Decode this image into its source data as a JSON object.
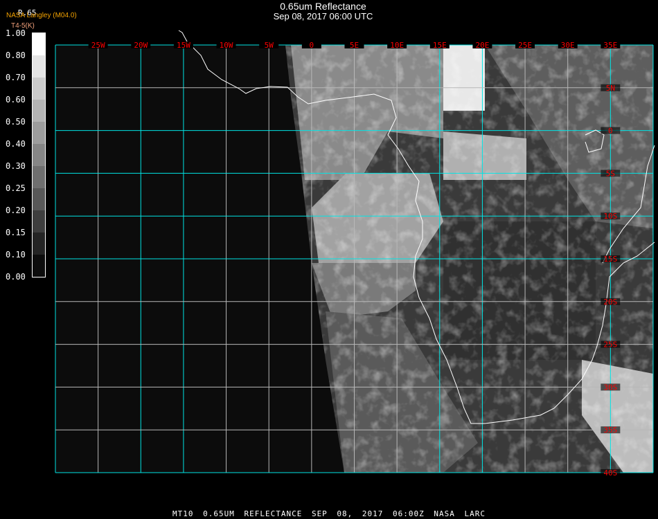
{
  "header": {
    "title": "0.65um Reflectance",
    "subtitle": "Sep 08, 2017 06:00 UTC",
    "band_label": "R.65",
    "organization": "NASA Langley (M04.0)",
    "secondary_label": "T4-5(K)"
  },
  "colorbar": {
    "labels": [
      "1.00",
      "0.80",
      "0.70",
      "0.60",
      "0.50",
      "0.40",
      "0.30",
      "0.25",
      "0.20",
      "0.15",
      "0.10",
      "0.00"
    ],
    "colors": [
      "#ffffff",
      "#e4e4e4",
      "#cbcbcb",
      "#b4b4b4",
      "#9d9d9d",
      "#868686",
      "#6f6f6f",
      "#585858",
      "#3e3e3e",
      "#242424",
      "#0c0c0c"
    ]
  },
  "map": {
    "lon_range": [
      -30,
      40
    ],
    "lat_range": [
      10,
      -40
    ],
    "longitudes": [
      {
        "value": -25,
        "label": "25W"
      },
      {
        "value": -20,
        "label": "20W"
      },
      {
        "value": -15,
        "label": "15W"
      },
      {
        "value": -10,
        "label": "10W"
      },
      {
        "value": -5,
        "label": "5W"
      },
      {
        "value": 0,
        "label": "0"
      },
      {
        "value": 5,
        "label": "5E"
      },
      {
        "value": 10,
        "label": "10E"
      },
      {
        "value": 15,
        "label": "15E"
      },
      {
        "value": 20,
        "label": "20E"
      },
      {
        "value": 25,
        "label": "25E"
      },
      {
        "value": 30,
        "label": "30E"
      },
      {
        "value": 35,
        "label": "35E"
      }
    ],
    "latitudes": [
      {
        "value": 5,
        "label": "5N"
      },
      {
        "value": 0,
        "label": "0"
      },
      {
        "value": -5,
        "label": "5S"
      },
      {
        "value": -10,
        "label": "10S"
      },
      {
        "value": -15,
        "label": "15S"
      },
      {
        "value": -20,
        "label": "20S"
      },
      {
        "value": -25,
        "label": "25S"
      },
      {
        "value": -30,
        "label": "30S"
      },
      {
        "value": -35,
        "label": "35S"
      },
      {
        "value": -40,
        "label": "40S"
      }
    ],
    "grid_color": "#00e5e5",
    "label_color": "#ff0000",
    "coast_color": "#ffffff"
  },
  "footer": {
    "text": "MT10  0.65UM REFLECTANCE   SEP 08, 2017 06:00Z   NASA LARC"
  }
}
